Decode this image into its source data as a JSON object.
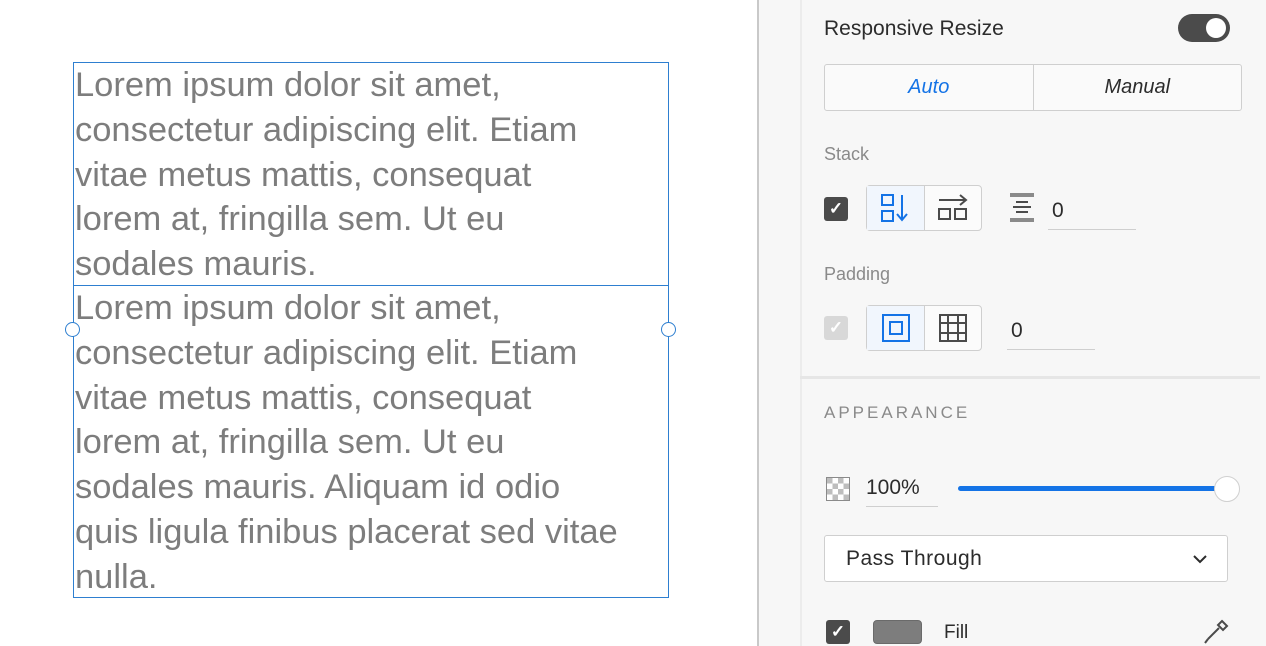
{
  "canvas": {
    "text_box_1": {
      "lines": [
        "Lorem ipsum dolor sit amet,",
        "consectetur adipiscing elit. Etiam",
        "vitae metus mattis, consequat",
        "lorem at, fringilla sem. Ut eu",
        "sodales mauris."
      ]
    },
    "text_box_2": {
      "lines": [
        "Lorem ipsum dolor sit amet,",
        "consectetur adipiscing elit. Etiam",
        "vitae metus mattis, consequat",
        "lorem at, fringilla sem. Ut eu",
        "sodales mauris. Aliquam id odio",
        "quis ligula finibus placerat sed vitae",
        "nulla."
      ]
    },
    "text_color": "#7d7d7d",
    "selection_color": "#2e7fd0"
  },
  "panel": {
    "responsive_resize": {
      "label": "Responsive Resize",
      "enabled": true
    },
    "resize_mode": {
      "options": [
        "Auto",
        "Manual"
      ],
      "selected": "Auto"
    },
    "stack": {
      "label": "Stack",
      "checked": true,
      "direction_icons": [
        "stack-vertical-icon",
        "stack-horizontal-icon"
      ],
      "selected_direction": "stack-vertical-icon",
      "spacing_icon": "spacing-icon",
      "spacing_value": "0"
    },
    "padding": {
      "label": "Padding",
      "checked": true,
      "disabled": true,
      "mode_icons": [
        "padding-uniform-icon",
        "padding-individual-icon"
      ],
      "selected_mode": "padding-uniform-icon",
      "value": "0"
    },
    "appearance": {
      "title": "APPEARANCE",
      "opacity_icon": "transparency-icon",
      "opacity": "100%",
      "opacity_fraction": 1.0,
      "blend_mode": "Pass Through"
    },
    "fill": {
      "label": "Fill",
      "checked": true,
      "color": "#7d7d7d",
      "eyedropper_icon": "eyedropper-icon"
    },
    "accent_color": "#1473e6"
  }
}
